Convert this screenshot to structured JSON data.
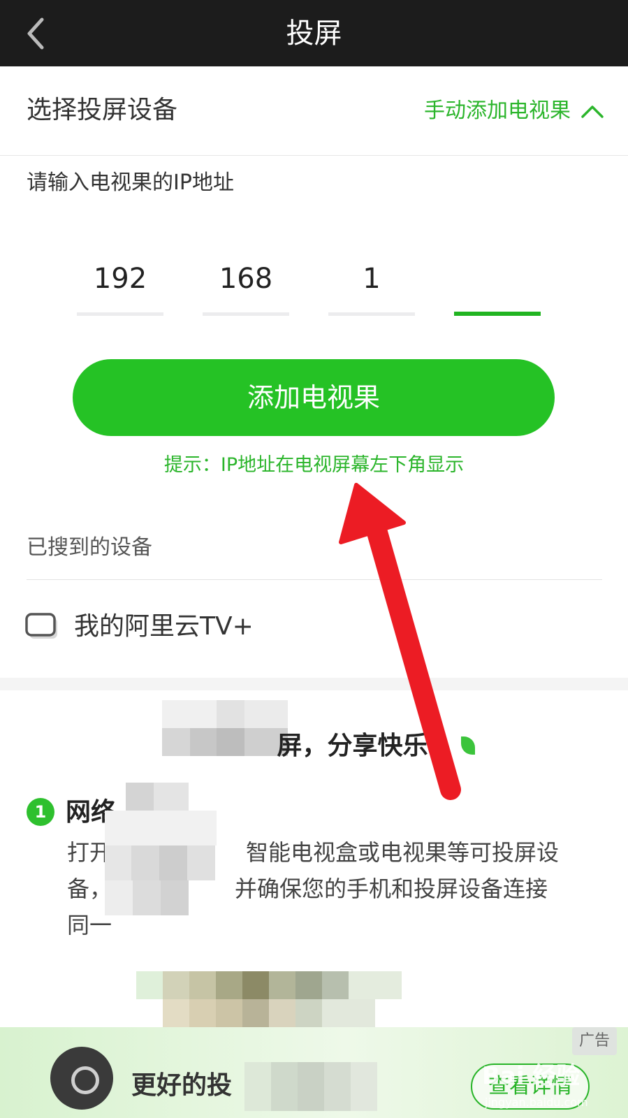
{
  "header": {
    "title": "投屏"
  },
  "section": {
    "title": "选择投屏设备",
    "manual_add_label": "手动添加电视果"
  },
  "ip_form": {
    "prompt": "请输入电视果的IP地址",
    "octets": [
      "192",
      "168",
      "1",
      ""
    ],
    "submit_label": "添加电视果",
    "tip": "提示：IP地址在电视屏幕左下角显示"
  },
  "devices": {
    "label": "已搜到的设备",
    "items": [
      {
        "name": "我的阿里云TV+"
      }
    ]
  },
  "guide": {
    "title": "屏，分享快乐",
    "step": {
      "number": "1",
      "title": "网络",
      "lines": [
        "打开　　　　　　智能电视盒或电视果等可投屏设",
        "备，　　　　　　并确保您的手机和投屏设备连接",
        "同一"
      ]
    }
  },
  "promo": {
    "ad_tag": "广告",
    "text": "更好的投",
    "button_label": "查看详情"
  },
  "watermark": {
    "brand": "Bai 经验",
    "url": "jingyan.baidu.com"
  },
  "colors": {
    "accent": "#25c225",
    "topbar": "#1c1c1c",
    "annotation_arrow": "#ec1c24"
  }
}
